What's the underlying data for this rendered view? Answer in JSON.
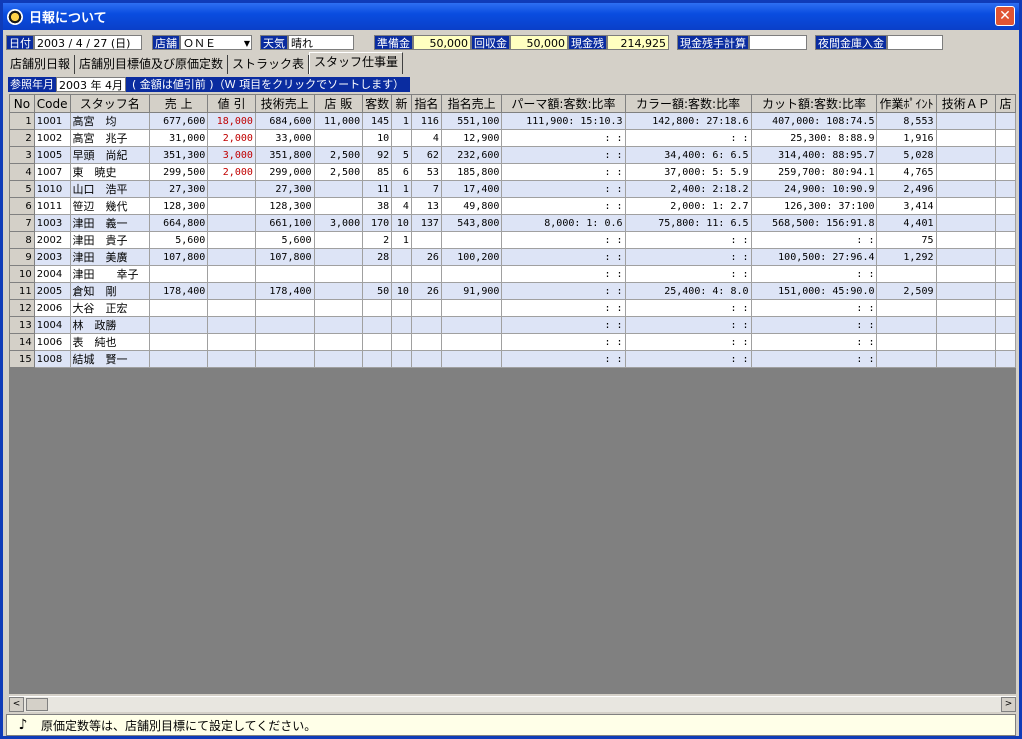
{
  "window": {
    "title": "日報について",
    "close_glyph": "✕"
  },
  "info_bar": {
    "date_label": "日付",
    "date_value": "2003 / 4 / 27 (日)",
    "store_label": "店舗",
    "store_value": "ＯＮＥ",
    "weather_label": "天気",
    "weather_value": "晴れ",
    "reserve_label": "準備金",
    "reserve_value": "50,000",
    "collect_label": "回収金",
    "collect_value": "50,000",
    "cash_label": "現金残",
    "cash_value": "214,925",
    "cash_calc_label": "現金残手計算",
    "cash_calc_value": "",
    "night_label": "夜間金庫入金",
    "night_value": ""
  },
  "tabs": [
    {
      "label": "店舗別日報"
    },
    {
      "label": "店舗別目標値及び原価定数"
    },
    {
      "label": "ストラック表"
    },
    {
      "label": "スタッフ仕事量"
    }
  ],
  "ref": {
    "label": "参照年月",
    "value": "2003 年  4月",
    "note": "( 金額は値引前 )（Ｗ 項目をクリックでソートします）"
  },
  "table": {
    "headers": [
      "No",
      "Code",
      "スタッフ名",
      "売 上",
      "値 引",
      "技術売上",
      "店 販",
      "客数",
      "新",
      "指名",
      "指名売上",
      "パーマ額:客数:比率",
      "カラー額:客数:比率",
      "カット額:客数:比率",
      "作業ﾎﾟｲﾝﾄ",
      "技術ＡＰ",
      "店"
    ],
    "rows": [
      [
        "1",
        "1001",
        "高宮　均",
        "677,600",
        "18,000",
        "684,600",
        "11,000",
        "145",
        "1",
        "116",
        "551,100",
        "111,900:  15:10.3",
        "142,800:  27:18.6",
        "407,000: 108:74.5",
        "8,553",
        "",
        ""
      ],
      [
        "2",
        "1002",
        "高宮　兆子",
        "31,000",
        "2,000",
        "33,000",
        "",
        "10",
        "",
        "4",
        "12,900",
        ":   :",
        ":   :",
        "25,300:   8:88.9",
        "1,916",
        "",
        ""
      ],
      [
        "3",
        "1005",
        "早頭　尚紀",
        "351,300",
        "3,000",
        "351,800",
        "2,500",
        "92",
        "5",
        "62",
        "232,600",
        ":   :",
        "34,400:   6: 6.5",
        "314,400:  88:95.7",
        "5,028",
        "",
        ""
      ],
      [
        "4",
        "1007",
        "東　暁史",
        "299,500",
        "2,000",
        "299,000",
        "2,500",
        "85",
        "6",
        "53",
        "185,800",
        ":   :",
        "37,000:   5: 5.9",
        "259,700:  80:94.1",
        "4,765",
        "",
        ""
      ],
      [
        "5",
        "1010",
        "山口　浩平",
        "27,300",
        "",
        "27,300",
        "",
        "11",
        "1",
        "7",
        "17,400",
        ":   :",
        "2,400:   2:18.2",
        "24,900:  10:90.9",
        "2,496",
        "",
        ""
      ],
      [
        "6",
        "1011",
        "笹辺　幾代",
        "128,300",
        "",
        "128,300",
        "",
        "38",
        "4",
        "13",
        "49,800",
        ":   :",
        "2,000:   1: 2.7",
        "126,300:  37:100",
        "3,414",
        "",
        ""
      ],
      [
        "7",
        "1003",
        "津田　義一",
        "664,800",
        "",
        "661,100",
        "3,000",
        "170",
        "10",
        "137",
        "543,800",
        "8,000:   1: 0.6",
        "75,800:  11: 6.5",
        "568,500: 156:91.8",
        "4,401",
        "",
        ""
      ],
      [
        "8",
        "2002",
        "津田　貴子",
        "5,600",
        "",
        "5,600",
        "",
        "2",
        "1",
        "",
        "",
        ":   :",
        ":   :",
        ":   :",
        "75",
        "",
        ""
      ],
      [
        "9",
        "2003",
        "津田　美廣",
        "107,800",
        "",
        "107,800",
        "",
        "28",
        "",
        "26",
        "100,200",
        ":   :",
        ":   :",
        "100,500:  27:96.4",
        "1,292",
        "",
        ""
      ],
      [
        "10",
        "2004",
        "津田　　幸子",
        "",
        "",
        "",
        "",
        "",
        "",
        "",
        "",
        ":   :",
        ":   :",
        ":   :",
        "",
        "",
        ""
      ],
      [
        "11",
        "2005",
        "倉知　剛",
        "178,400",
        "",
        "178,400",
        "",
        "50",
        "10",
        "26",
        "91,900",
        ":   :",
        "25,400:   4: 8.0",
        "151,000:  45:90.0",
        "2,509",
        "",
        ""
      ],
      [
        "12",
        "2006",
        "大谷　正宏",
        "",
        "",
        "",
        "",
        "",
        "",
        "",
        "",
        ":   :",
        ":   :",
        ":   :",
        "",
        "",
        ""
      ],
      [
        "13",
        "1004",
        "林　政勝",
        "",
        "",
        "",
        "",
        "",
        "",
        "",
        "",
        ":   :",
        ":   :",
        ":   :",
        "",
        "",
        ""
      ],
      [
        "14",
        "1006",
        "表　純也",
        "",
        "",
        "",
        "",
        "",
        "",
        "",
        "",
        ":   :",
        ":   :",
        ":   :",
        "",
        "",
        ""
      ],
      [
        "15",
        "1008",
        "結城　賢一",
        "",
        "",
        "",
        "",
        "",
        "",
        "",
        "",
        ":   :",
        ":   :",
        ":   :",
        "",
        "",
        ""
      ]
    ]
  },
  "scroll": {
    "left_glyph": "<",
    "right_glyph": ">"
  },
  "status": {
    "icon": "note-icon",
    "message": "原価定数等は、店舗別目標にて設定してください。",
    "glyph": "♪"
  }
}
